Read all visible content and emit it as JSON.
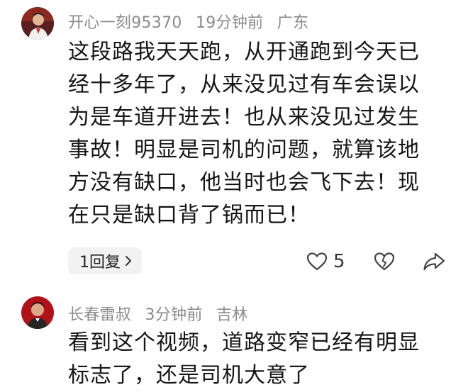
{
  "comments": [
    {
      "username": "开心一刻95370",
      "time": "19分钟前",
      "location": "广东",
      "lines": [
        "这段路我天天跑，从开通跑到今天已",
        "经十多年了，从来没见过有车会误以",
        "为是车道开进去！也从来没见过发生",
        "事故！明显是司机的问题，就算该地",
        "方没有缺口，他当时也会飞下去！现",
        "在只是缺口背了锅而已！"
      ],
      "reply_label": "1回复",
      "like_count": "5"
    },
    {
      "username": "长春雷叔",
      "time": "3分钟前",
      "location": "吉林",
      "lines": [
        "看到这个视频，道路变窄已经有明显",
        "标志了，还是司机大意了"
      ]
    }
  ],
  "icons": {
    "reply_chevron": "chevron-right-icon",
    "like": "heart-icon",
    "dislike": "broken-heart-icon",
    "share": "share-icon"
  },
  "colors": {
    "meta_text": "#8a8a8a",
    "body_text": "#161616",
    "chip_bg": "#f2f2f2"
  }
}
